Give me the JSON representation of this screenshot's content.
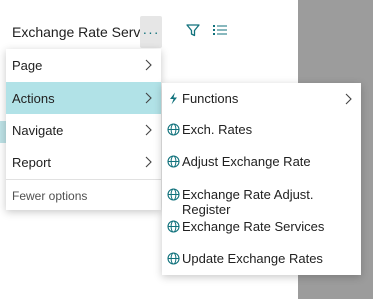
{
  "header": {
    "title": "Exchange Rate Service",
    "more_label": "···"
  },
  "menu": {
    "items": [
      {
        "label": "Page"
      },
      {
        "label": "Actions"
      },
      {
        "label": "Navigate"
      },
      {
        "label": "Report"
      }
    ],
    "fewer_label": "Fewer options"
  },
  "submenu": {
    "items": [
      {
        "label": "Functions",
        "icon": "lightning-icon"
      },
      {
        "label": "Exch. Rates",
        "icon": "globe-icon"
      },
      {
        "label": "Adjust Exchange Rate",
        "icon": "globe-icon"
      },
      {
        "label": "Exchange Rate Adjust. Register",
        "icon": "globe-icon"
      },
      {
        "label": "Exchange Rate Services",
        "icon": "globe-icon"
      },
      {
        "label": "Update Exchange Rates",
        "icon": "globe-icon"
      }
    ]
  },
  "colors": {
    "accent": "#11727c",
    "active_bg": "#b1e2e7"
  }
}
